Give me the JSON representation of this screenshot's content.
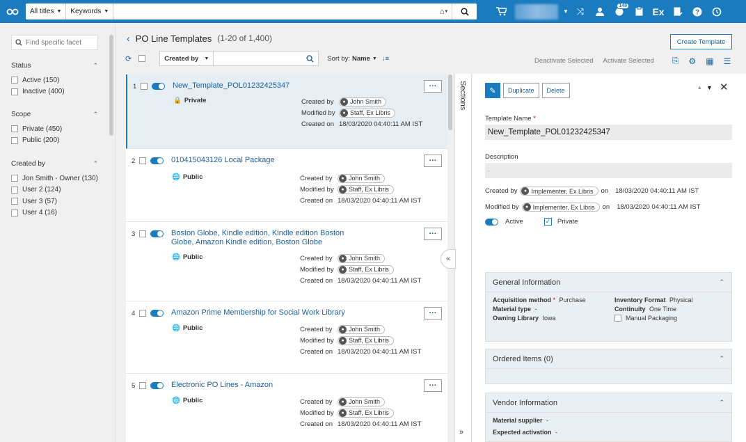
{
  "topbar": {
    "scope": "All titles",
    "field": "Keywords",
    "notification_count": "149"
  },
  "facets": {
    "search_placeholder": "Find specific facet",
    "groups": [
      {
        "title": "Status",
        "items": [
          "Active (150)",
          "Inactive (400)"
        ]
      },
      {
        "title": "Scope",
        "items": [
          "Private (450)",
          "Public (200)"
        ]
      },
      {
        "title": "Created by",
        "items": [
          "Jon Smith - Owner (130)",
          "User 2 (124)",
          "User 3 (57)",
          "User 4 (16)"
        ]
      }
    ]
  },
  "list": {
    "title": "PO Line Templates",
    "count": "(1-20 of 1,400)",
    "filter_label": "Created by",
    "sort_label": "Sort by:",
    "sort_value": "Name",
    "deactivate": "Deactivate Selected",
    "activate": "Activate Selected",
    "create": "Create Template",
    "meta_labels": {
      "created_by": "Created by",
      "modified_by": "Modified by",
      "created_on": "Created on"
    },
    "items": [
      {
        "num": "1",
        "title": "New_Template_POL01232425347",
        "visibility": "Private",
        "created_by": "John Smith",
        "modified_by": "Staff, Ex Libris",
        "created_on": "18/03/2020 04:40:11 AM IST"
      },
      {
        "num": "2",
        "title": "010415043126 Local Package",
        "visibility": "Public",
        "created_by": "John Smith",
        "modified_by": "Staff, Ex Libris",
        "created_on": "18/03/2020 04:40:11 AM IST"
      },
      {
        "num": "3",
        "title": "Boston Globe, Kindle edition, Kindle edition Boston Globe, Amazon Kindle edition, Boston Globe",
        "visibility": "Public",
        "created_by": "John Smith",
        "modified_by": "Staff, Ex Libris",
        "created_on": "18/03/2020 04:40:11 AM IST"
      },
      {
        "num": "4",
        "title": "Amazon Prime Membership for Social Work Library",
        "visibility": "Public",
        "created_by": "John Smith",
        "modified_by": "Staff, Ex Libris",
        "created_on": "18/03/2020 04:40:11 AM IST"
      },
      {
        "num": "5",
        "title": "Electronic PO Lines - Amazon",
        "visibility": "Public",
        "created_by": "John Smith",
        "modified_by": "Staff, Ex Libris",
        "created_on": "18/03/2020 04:40:11 AM IST"
      }
    ]
  },
  "sections_label": "Sections",
  "detail": {
    "duplicate": "Duplicate",
    "delete": "Delete",
    "name_label": "Template Name",
    "required_mark": "*",
    "name_value": "New_Template_POL01232425347",
    "desc_label": "Description",
    "desc_value": "-",
    "created_by_label": "Created by",
    "created_by": "Implementer, Ex Libris",
    "on": "on",
    "created_on": "18/03/2020 04:40:11 AM IST",
    "modified_by_label": "Modified by",
    "modified_by": "Implementer, Ex Libris",
    "modified_on": "18/03/2020 04:40:11 AM IST",
    "active_label": "Active",
    "private_label": "Private",
    "general": {
      "title": "General Information",
      "acq_label": "Acquisition method",
      "acq_value": "Purchase",
      "inv_label": "Inventory Format",
      "inv_value": "Physical",
      "mat_label": "Material type",
      "mat_value": "-",
      "cont_label": "Continuity",
      "cont_value": "One Time",
      "own_label": "Owning Library",
      "own_value": "Iowa",
      "manual_label": "Manual Packaging"
    },
    "ordered": {
      "title": "Ordered Items (0)"
    },
    "vendor": {
      "title": "Vendor Information",
      "supplier_label": "Material supplier",
      "supplier_value": "-",
      "activation_label": "Expected activation",
      "activation_value": "-"
    }
  }
}
